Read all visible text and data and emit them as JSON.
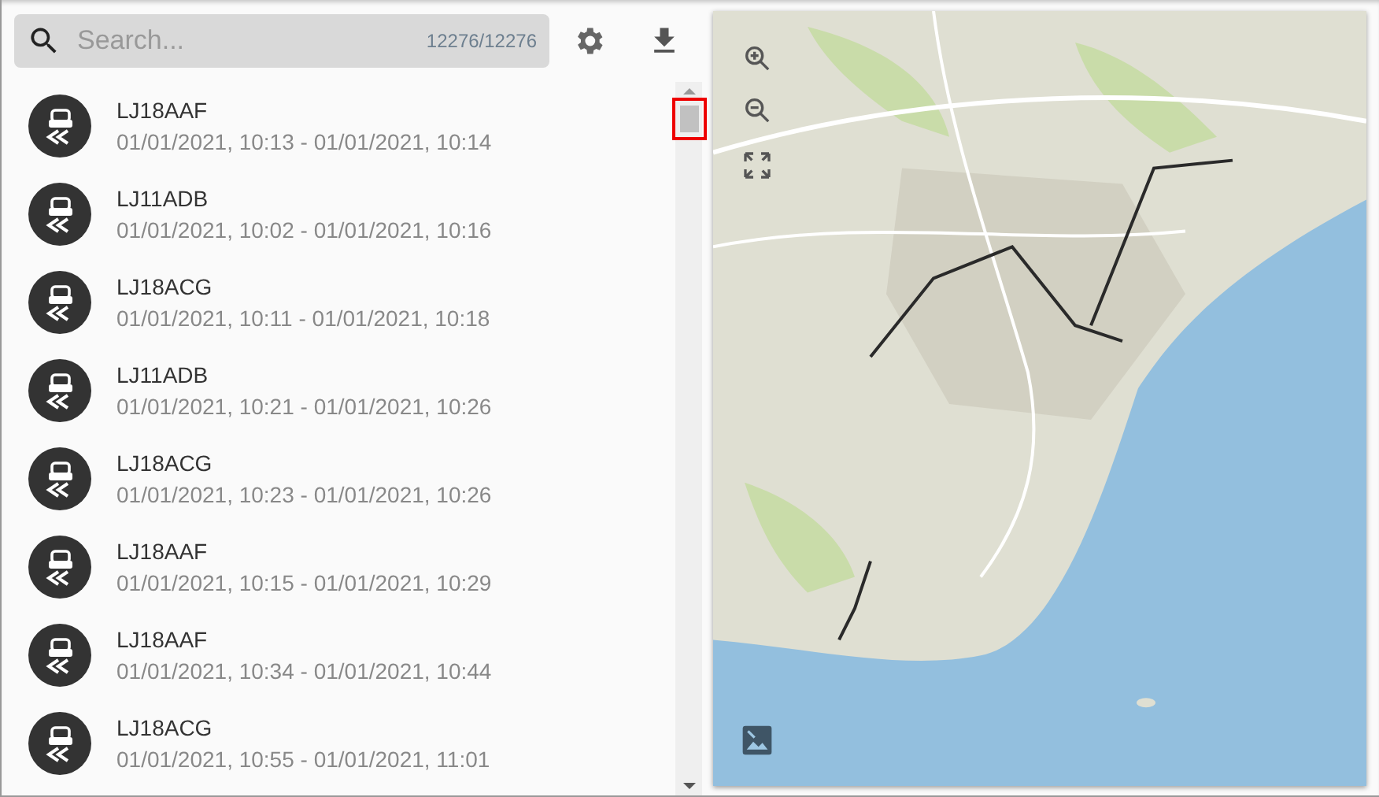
{
  "search": {
    "placeholder": "Search...",
    "count": "12276/12276"
  },
  "trips": [
    {
      "plate": "LJ18AAF",
      "period": "01/01/2021, 10:13 - 01/01/2021, 10:14"
    },
    {
      "plate": "LJ11ADB",
      "period": "01/01/2021, 10:02 - 01/01/2021, 10:16"
    },
    {
      "plate": "LJ18ACG",
      "period": "01/01/2021, 10:11 - 01/01/2021, 10:18"
    },
    {
      "plate": "LJ11ADB",
      "period": "01/01/2021, 10:21 - 01/01/2021, 10:26"
    },
    {
      "plate": "LJ18ACG",
      "period": "01/01/2021, 10:23 - 01/01/2021, 10:26"
    },
    {
      "plate": "LJ18AAF",
      "period": "01/01/2021, 10:15 - 01/01/2021, 10:29"
    },
    {
      "plate": "LJ18AAF",
      "period": "01/01/2021, 10:34 - 01/01/2021, 10:44"
    },
    {
      "plate": "LJ18ACG",
      "period": "01/01/2021, 10:55 - 01/01/2021, 11:01"
    }
  ]
}
